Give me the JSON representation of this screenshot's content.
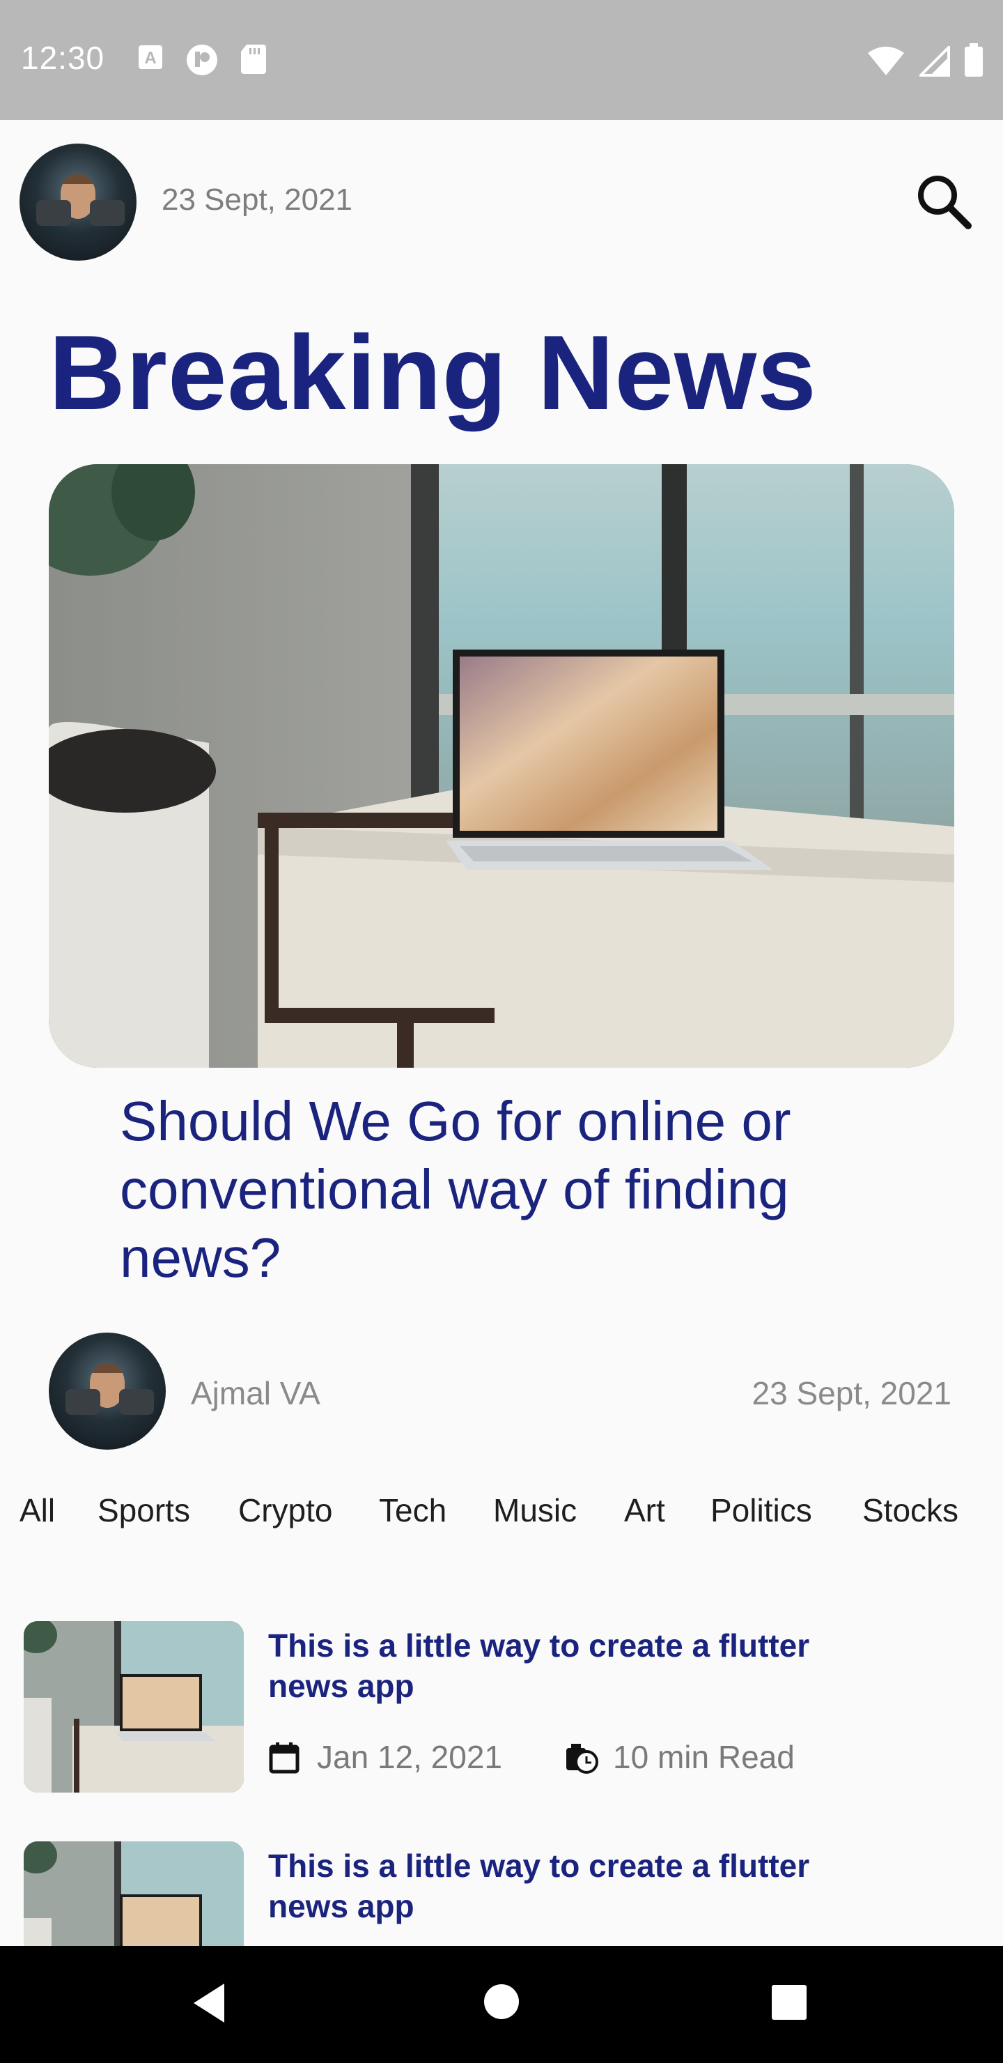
{
  "status_bar": {
    "time": "12:30"
  },
  "header": {
    "date": "23 Sept, 2021"
  },
  "page": {
    "title": "Breaking News"
  },
  "hero": {
    "headline": "Should We Go for online or conventional way of finding news?"
  },
  "author": {
    "name": "Ajmal VA",
    "date": "23 Sept, 2021"
  },
  "categories": [
    "All",
    "Sports",
    "Crypto",
    "Tech",
    "Music",
    "Art",
    "Politics",
    "Stocks"
  ],
  "articles": [
    {
      "title": "This is a little way to create a flutter news app",
      "date": "Jan 12, 2021",
      "read_time": "10 min Read"
    },
    {
      "title": "This is a little way to create a flutter news app"
    }
  ],
  "colors": {
    "accent": "#1a237e",
    "muted_text": "#7d7d7d",
    "status_bar": "#b8b8b8",
    "nav_bar": "#000000"
  },
  "icons": {
    "search": "search-icon",
    "calendar": "calendar-icon",
    "timer": "timer-icon",
    "back": "back-icon",
    "home": "home-icon",
    "recents": "recents-icon"
  }
}
